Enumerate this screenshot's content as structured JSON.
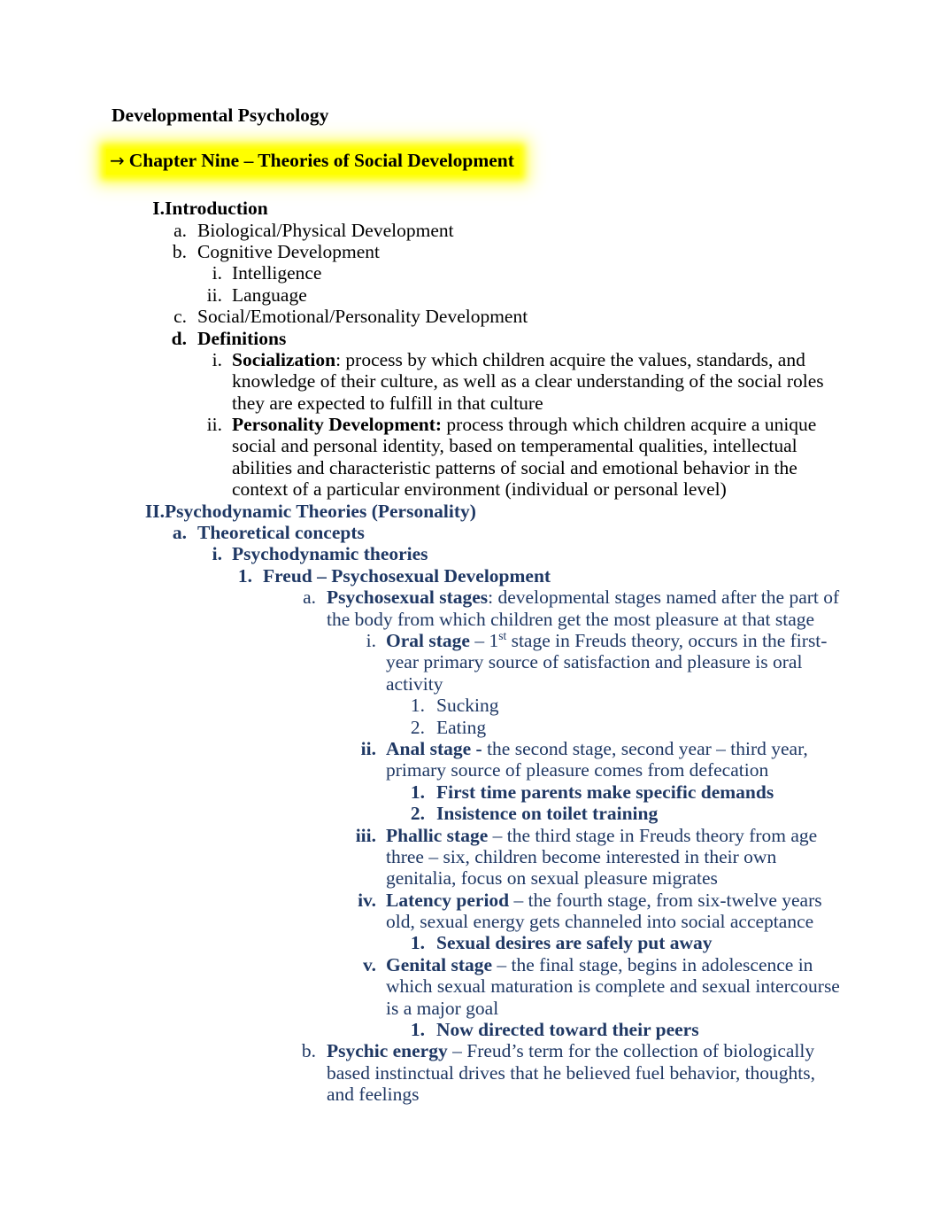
{
  "document": {
    "title": "Developmental Psychology",
    "chapter_heading": {
      "arrow": "→",
      "text": "Chapter Nine – Theories of Social Development",
      "highlight_color": "#FFFF00"
    },
    "colors": {
      "body_black": "#000000",
      "section_blue": "#1F3864",
      "highlight_yellow": "#FFFF00"
    }
  },
  "outline": {
    "section_1": {
      "marker": "I.",
      "title": "Introduction",
      "a": {
        "marker": "a.",
        "text": "Biological/Physical Development"
      },
      "b": {
        "marker": "b.",
        "text": "Cognitive Development"
      },
      "b_i": {
        "marker": "i.",
        "text": "Intelligence"
      },
      "b_ii": {
        "marker": "ii.",
        "text": "Language"
      },
      "c": {
        "marker": "c.",
        "text": "Social/Emotional/Personality Development"
      },
      "d": {
        "marker": "d.",
        "text": "Definitions"
      },
      "d_i": {
        "marker": "i.",
        "term": "Socialization",
        "separator": ": ",
        "body": "process by which children acquire the values, standards, and knowledge of their culture, as well as a clear understanding of the social roles they are expected to fulfill in that culture"
      },
      "d_ii": {
        "marker": "ii.",
        "term": "Personality Development:",
        "separator": " ",
        "body": "process through which children acquire a unique social and personal identity, based on temperamental qualities, intellectual abilities and characteristic patterns of social and emotional behavior in the context of a particular environment (individual or personal level)"
      }
    },
    "section_2": {
      "marker": "II.",
      "title": "Psychodynamic Theories (Personality)",
      "a": {
        "marker": "a.",
        "text": "Theoretical concepts"
      },
      "a_i": {
        "marker": "i.",
        "text": "Psychodynamic theories"
      },
      "a_i_1": {
        "marker": "1.",
        "text": "Freud – Psychosexual Development"
      },
      "stages_intro": {
        "marker": "a.",
        "term": "Psychosexual stages",
        "separator": ": ",
        "body": "developmental stages named after the part of the body from which children get the most pleasure at that stage"
      },
      "stage_oral": {
        "marker": "i.",
        "term": "Oral stage",
        "separator": " – ",
        "body_pre": "1",
        "body_sup": "st",
        "body_post": " stage in Freuds theory, occurs in the first-year primary source of satisfaction and pleasure is oral activity",
        "sub": [
          {
            "marker": "1.",
            "text": "Sucking",
            "bold": false
          },
          {
            "marker": "2.",
            "text": "Eating",
            "bold": false
          }
        ]
      },
      "stage_anal": {
        "marker": "ii.",
        "term": "Anal stage -",
        "separator": " ",
        "body": "the second stage, second year – third year, primary source of pleasure comes from defecation",
        "sub": [
          {
            "marker": "1.",
            "text": "First time parents make specific demands",
            "bold": true
          },
          {
            "marker": "2.",
            "text": "Insistence on toilet training",
            "bold": true
          }
        ]
      },
      "stage_phallic": {
        "marker": "iii.",
        "term": "Phallic stage",
        "separator": " – ",
        "body": "the third stage in Freuds theory from age three – six, children become interested in their own genitalia, focus on sexual pleasure migrates",
        "sub": []
      },
      "stage_latency": {
        "marker": "iv.",
        "term": "Latency period",
        "separator": " – ",
        "body": "the fourth stage, from six-twelve years old, sexual energy gets channeled into social acceptance",
        "sub": [
          {
            "marker": "1.",
            "text": "Sexual desires are safely put away",
            "bold": true
          }
        ]
      },
      "stage_genital": {
        "marker": "v.",
        "term": "Genital stage",
        "separator": " – ",
        "body": "the final stage, begins in adolescence in which sexual maturation is complete and sexual intercourse is a major goal",
        "sub": [
          {
            "marker": "1.",
            "text": "Now directed toward their peers",
            "bold": true
          }
        ]
      },
      "psychic_energy": {
        "marker": "b.",
        "term": "Psychic energy",
        "separator": " – ",
        "body": "Freud’s term for the collection of biologically based instinctual drives that he believed fuel behavior, thoughts, and feelings"
      }
    }
  }
}
